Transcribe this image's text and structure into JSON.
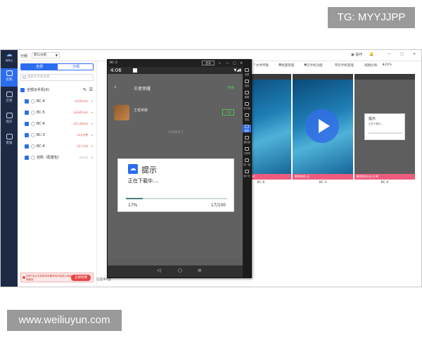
{
  "watermark_top": "TG: MYYJJPP",
  "watermark_bottom": "www.weiliuyun.com",
  "app": {
    "logo_text": "雨林云",
    "nav": [
      "云机",
      "云盘",
      "购买",
      "客服"
    ],
    "group_label": "分组",
    "group_value": "默认分组",
    "tabs": [
      "全部",
      "分组"
    ],
    "search_placeholder": "搜索云手机名称",
    "all_label": "全部云手机(6)",
    "devices": [
      {
        "name": "BC-4",
        "status": "6小时28分"
      },
      {
        "name": "BC-5",
        "status": "3天6时18分"
      },
      {
        "name": "BC-6",
        "status": "5天14时9分"
      },
      {
        "name": "BC-3",
        "status": "1天9分钟"
      },
      {
        "name": "BC-4",
        "status": "2天7小时"
      },
      {
        "name": "自购（配置包）",
        "status": "VIP1天"
      }
    ],
    "promo_text": "您有3台云手机即将到期请及时续费以免影响使用",
    "promo_button": "立即续费",
    "topbar_right": [
      "操作",
      "通知"
    ],
    "toolbar": [
      "文件传输",
      "批量管理",
      "云手机功能",
      "云手机管理",
      "视图比例:",
      "120%"
    ],
    "cards": [
      {
        "label": "BC-6",
        "foot": "剩余时间3天6小时"
      },
      {
        "label": "BC-3",
        "foot": "剩余时间1天"
      },
      {
        "label": "BC-4",
        "foot": "剩余时间2天7小时"
      }
    ],
    "mini_dialog": {
      "title": "提示",
      "text": "正在下载中..."
    },
    "bottom_status": "已选中0台"
  },
  "phone": {
    "window_title": "BC-3",
    "quality": "超清",
    "time": "4:06",
    "app_title": "王者荣耀",
    "search_action": "搜索",
    "game_name": "王者荣耀",
    "game_action": "下载",
    "no_more": "没有更多了",
    "dialog": {
      "title": "提示",
      "message": "正在下载中....",
      "percent_text": "17%",
      "fraction_text": "17/100",
      "progress": 0.17
    },
    "side_tools": [
      "全屏",
      "音量",
      "截图",
      "剪切板",
      "重启",
      "更多",
      "虚拟键",
      "分辨率",
      "摇一摇",
      "最小化"
    ]
  }
}
